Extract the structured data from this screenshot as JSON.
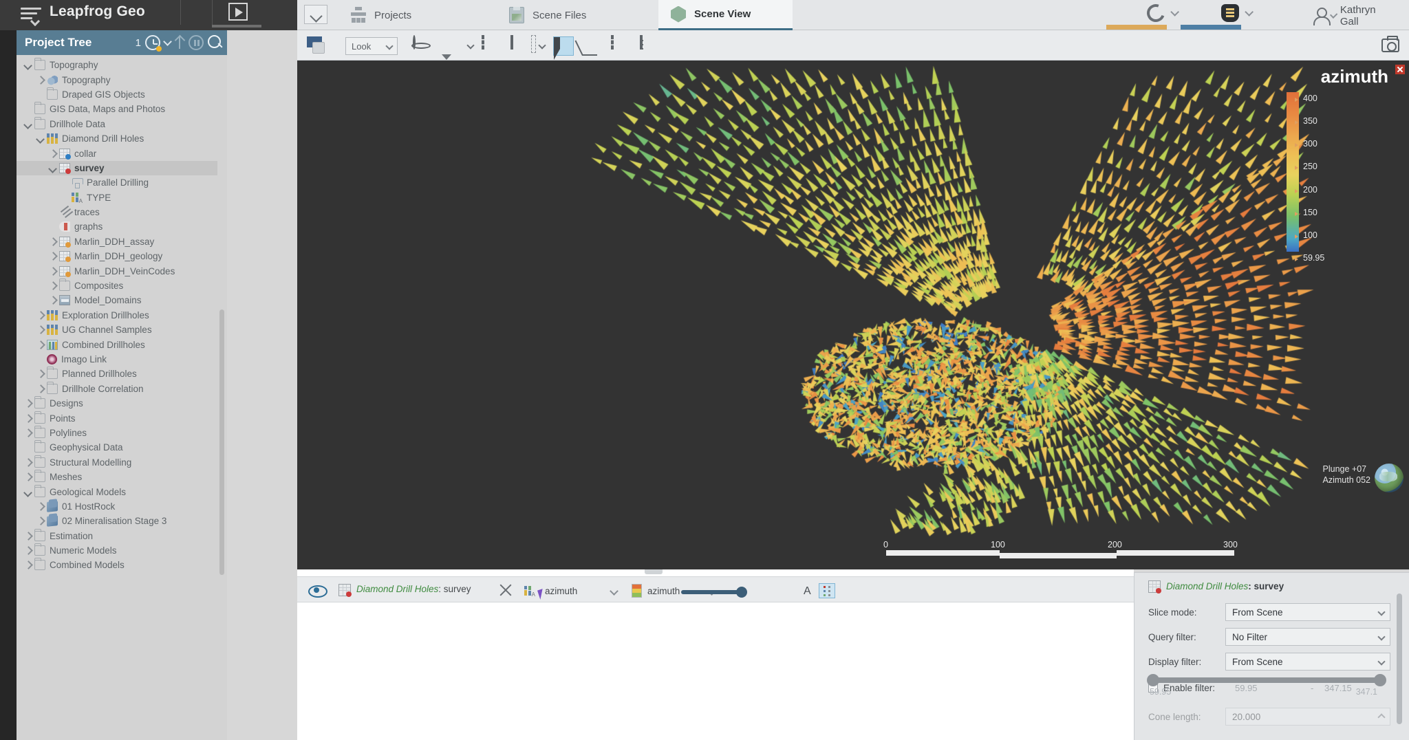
{
  "app": {
    "title": "Leapfrog Geo",
    "menu_icon": "hamburger-menu-icon",
    "play_icon": "play-icon"
  },
  "tabs": [
    {
      "label": "Projects",
      "icon": "projects-icon",
      "active": false
    },
    {
      "label": "Scene Files",
      "icon": "scene-files-icon",
      "active": false
    },
    {
      "label": "Scene View",
      "icon": "scene-view-icon",
      "active": true
    }
  ],
  "header_right": {
    "central_icon": "central-c-icon",
    "bentley_icon": "bentley-logo-icon",
    "user_icon": "user-avatar-icon",
    "user_name": "Kathryn Gall",
    "accent_orange": "#dca95a",
    "accent_blue": "#4e7fa5"
  },
  "project_tree": {
    "header": {
      "title": "Project Tree",
      "count": "1",
      "clock_icon": "history-clock-icon",
      "up_icon": "upload-arrow-icon",
      "pause_icon": "pause-circle-icon",
      "search_icon": "search-icon"
    },
    "items": [
      {
        "label": "Topography",
        "indent": 1,
        "chev": "down",
        "icon": "folder-icon"
      },
      {
        "label": "Topography",
        "indent": 2,
        "chev": "right",
        "icon": "topography-icon"
      },
      {
        "label": "Draped GIS Objects",
        "indent": 2,
        "chev": "none",
        "icon": "folder-icon"
      },
      {
        "label": "GIS Data, Maps and Photos",
        "indent": 1,
        "chev": "none",
        "icon": "folder-icon"
      },
      {
        "label": "Drillhole Data",
        "indent": 1,
        "chev": "down",
        "icon": "folder-icon"
      },
      {
        "label": "Diamond Drill Holes",
        "indent": 2,
        "chev": "down",
        "icon": "drillholes-icon"
      },
      {
        "label": "collar",
        "indent": 3,
        "chev": "right",
        "icon": "table-blue-icon"
      },
      {
        "label": "survey",
        "indent": 3,
        "chev": "down",
        "icon": "table-red-icon",
        "selected": true,
        "bold": true
      },
      {
        "label": "Parallel Drilling",
        "indent": 4,
        "chev": "none",
        "icon": "filter-funnel-icon"
      },
      {
        "label": "TYPE",
        "indent": 4,
        "chev": "none",
        "icon": "category-column-icon"
      },
      {
        "label": "traces",
        "indent": 3,
        "chev": "none",
        "icon": "traces-icon"
      },
      {
        "label": "graphs",
        "indent": 3,
        "chev": "none",
        "icon": "graphs-icon"
      },
      {
        "label": "Marlin_DDH_assay",
        "indent": 3,
        "chev": "right",
        "icon": "table-orange-icon"
      },
      {
        "label": "Marlin_DDH_geology",
        "indent": 3,
        "chev": "right",
        "icon": "table-orange-icon"
      },
      {
        "label": "Marlin_DDH_VeinCodes",
        "indent": 3,
        "chev": "right",
        "icon": "table-orange-icon"
      },
      {
        "label": "Composites",
        "indent": 3,
        "chev": "right",
        "icon": "folder-icon"
      },
      {
        "label": "Model_Domains",
        "indent": 3,
        "chev": "right",
        "icon": "model-domains-icon"
      },
      {
        "label": "Exploration Drillholes",
        "indent": 2,
        "chev": "right",
        "icon": "drillholes-icon"
      },
      {
        "label": "UG Channel Samples",
        "indent": 2,
        "chev": "right",
        "icon": "drillholes-icon"
      },
      {
        "label": "Combined Drillholes",
        "indent": 2,
        "chev": "right",
        "icon": "combined-drillholes-icon"
      },
      {
        "label": "Imago Link",
        "indent": 2,
        "chev": "none",
        "icon": "imago-link-icon"
      },
      {
        "label": "Planned Drillholes",
        "indent": 2,
        "chev": "right",
        "icon": "folder-icon"
      },
      {
        "label": "Drillhole Correlation",
        "indent": 2,
        "chev": "right",
        "icon": "folder-icon"
      },
      {
        "label": "Designs",
        "indent": 1,
        "chev": "right",
        "icon": "folder-icon"
      },
      {
        "label": "Points",
        "indent": 1,
        "chev": "right",
        "icon": "folder-icon"
      },
      {
        "label": "Polylines",
        "indent": 1,
        "chev": "right",
        "icon": "folder-icon"
      },
      {
        "label": "Geophysical Data",
        "indent": 1,
        "chev": "none",
        "icon": "folder-icon"
      },
      {
        "label": "Structural Modelling",
        "indent": 1,
        "chev": "right",
        "icon": "folder-icon"
      },
      {
        "label": "Meshes",
        "indent": 1,
        "chev": "right",
        "icon": "folder-icon"
      },
      {
        "label": "Geological Models",
        "indent": 1,
        "chev": "down",
        "icon": "folder-icon"
      },
      {
        "label": "01 HostRock",
        "indent": 2,
        "chev": "right",
        "icon": "geological-model-icon"
      },
      {
        "label": "02 Mineralisation Stage 3",
        "indent": 2,
        "chev": "right",
        "icon": "geological-model-icon"
      },
      {
        "label": "Estimation",
        "indent": 1,
        "chev": "right",
        "icon": "folder-icon"
      },
      {
        "label": "Numeric Models",
        "indent": 1,
        "chev": "right",
        "icon": "folder-icon"
      },
      {
        "label": "Combined Models",
        "indent": 1,
        "chev": "right",
        "icon": "folder-icon"
      }
    ]
  },
  "scene_toolbar": {
    "snapshot_icon": "scene-snapshot-icon",
    "look_label": "Look",
    "tools": [
      {
        "name": "orbit-icon"
      },
      {
        "name": "draw-plane-icon"
      },
      {
        "name": "move-plane-icon"
      },
      {
        "name": "slicer-icon"
      },
      {
        "name": "select-cursor-icon",
        "selected": true
      },
      {
        "name": "measure-angle-icon"
      },
      {
        "name": "clipping-box-icon"
      },
      {
        "name": "ruler-icon"
      },
      {
        "name": "imago-icon"
      }
    ],
    "camera_icon": "camera-icon"
  },
  "legend": {
    "title": "azimuth",
    "close_icon": "close-icon",
    "ticks": [
      "400",
      "350",
      "300",
      "250",
      "200",
      "150",
      "100",
      "59.95"
    ]
  },
  "scene_overlay": {
    "plunge": "Plunge +07",
    "azimuth": "Azimuth 052",
    "globe_icon": "orientation-globe-icon",
    "scale_labels": [
      "0",
      "100",
      "200",
      "300"
    ]
  },
  "shape_list": {
    "visibility_icon": "eye-icon",
    "shape_icon": "table-red-icon",
    "shape_name_prefix": "Diamond Drill Holes",
    "shape_name_suffix": ": survey",
    "remove_icon": "close-icon",
    "colour_by_icon": "category-column-icon",
    "colour_by": "azimuth",
    "swatch_icon": "colour-ramp-swatch",
    "legend_field": "azimuth",
    "opacity_slider": "opacity-slider",
    "text_icon": "A",
    "legend_toggle_icon": "legend-toggle-icon"
  },
  "properties": {
    "title_prefix": "Diamond Drill Holes",
    "title_suffix": ": survey",
    "icon": "table-red-icon",
    "rows": [
      {
        "label": "Slice mode:",
        "value": "From Scene"
      },
      {
        "label": "Query filter:",
        "value": "No Filter"
      },
      {
        "label": "Display filter:",
        "value": "From Scene"
      }
    ],
    "enable_filter": {
      "label": "Enable filter:",
      "checked": false,
      "min": "59.95",
      "dash": "-",
      "max": "347.15"
    },
    "range": {
      "min_label": "59.95",
      "max_label": "347.1"
    },
    "cone_length": {
      "label": "Cone length:",
      "value": "20.000"
    }
  },
  "chart_data": {
    "type": "scatter",
    "title": "azimuth",
    "colormap": [
      "#3b6fc4",
      "#4da7c4",
      "#79c06a",
      "#bcd152",
      "#e8d25e",
      "#edc055",
      "#eca84e",
      "#e88a42",
      "#e2703a"
    ],
    "vmin": 59.95,
    "vmax": 400,
    "ticks": [
      400,
      350,
      300,
      250,
      200,
      150,
      100,
      59.95
    ],
    "background": "#333333"
  }
}
